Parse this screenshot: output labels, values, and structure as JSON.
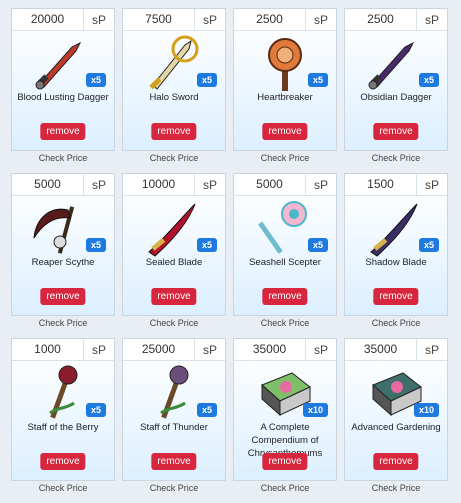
{
  "currency": "sP",
  "remove_label": "remove",
  "check_label": "Check Price",
  "items": [
    {
      "price": "20000",
      "qty": "x5",
      "name": "Blood Lusting Dagger",
      "icon": "dagger-icon",
      "color": "#c0392b"
    },
    {
      "price": "7500",
      "qty": "x5",
      "name": "Halo Sword",
      "icon": "sword-icon",
      "color": "#d4a017"
    },
    {
      "price": "2500",
      "qty": "x5",
      "name": "Heartbreaker",
      "icon": "hammer-icon",
      "color": "#e07a3a"
    },
    {
      "price": "2500",
      "qty": "x5",
      "name": "Obsidian Dagger",
      "icon": "dagger-icon",
      "color": "#4a2a6a"
    },
    {
      "price": "5000",
      "qty": "x5",
      "name": "Reaper Scythe",
      "icon": "scythe-icon",
      "color": "#5a1b1b"
    },
    {
      "price": "10000",
      "qty": "x5",
      "name": "Sealed Blade",
      "icon": "blade-icon",
      "color": "#b3122a"
    },
    {
      "price": "5000",
      "qty": "x5",
      "name": "Seashell Scepter",
      "icon": "scepter-icon",
      "color": "#4cb7c8"
    },
    {
      "price": "1500",
      "qty": "x5",
      "name": "Shadow Blade",
      "icon": "blade-icon",
      "color": "#3b2e66"
    },
    {
      "price": "1000",
      "qty": "x5",
      "name": "Staff of the Berry",
      "icon": "staff-icon",
      "color": "#8a1d2c"
    },
    {
      "price": "25000",
      "qty": "x5",
      "name": "Staff of Thunder",
      "icon": "staff-icon",
      "color": "#6b4f7a"
    },
    {
      "price": "35000",
      "qty": "x10",
      "name": "A Complete Compendium of Chrysanthemums",
      "icon": "book-icon",
      "color": "#7fbf6a"
    },
    {
      "price": "35000",
      "qty": "x10",
      "name": "Advanced Gardening",
      "icon": "book-icon",
      "color": "#3f6f6a"
    }
  ]
}
